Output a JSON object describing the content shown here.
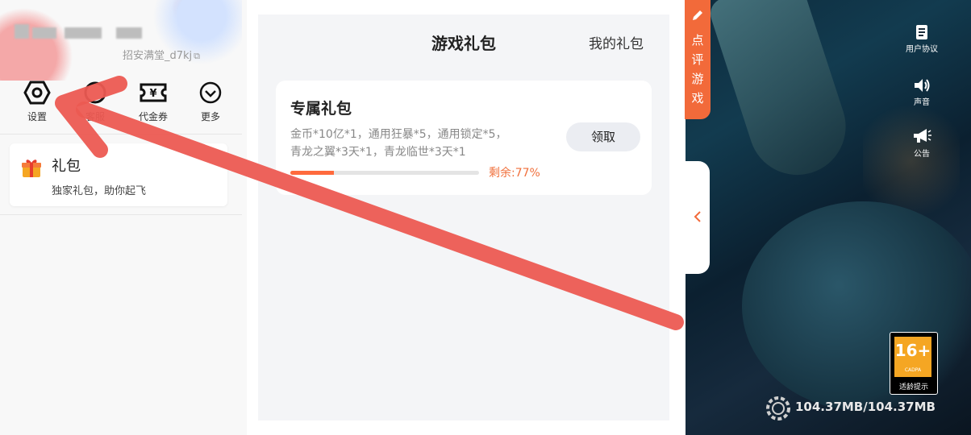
{
  "profile": {
    "uid_text": "招安满堂_d7kj"
  },
  "quick_actions": [
    {
      "label": "设置",
      "icon": "settings-hexagon-icon"
    },
    {
      "label": "客服",
      "icon": "service-icon"
    },
    {
      "label": "代金券",
      "icon": "voucher-icon"
    },
    {
      "label": "更多",
      "icon": "more-chevron-icon"
    }
  ],
  "gift_card": {
    "title": "礼包",
    "subtitle": "独家礼包，助你起飞",
    "icon": "gift-box-icon"
  },
  "gift_page": {
    "title": "游戏礼包",
    "my_gifts_link": "我的礼包",
    "package": {
      "title": "专属礼包",
      "desc_line1": "金币*10亿*1，通用狂暴*5，通用锁定*5，",
      "desc_line2": "青龙之翼*3天*1，青龙临世*3天*1",
      "claim_label": "领取",
      "remaining_text": "剩余:77%",
      "progress_fraction": 0.23
    }
  },
  "game_side": {
    "comment_tab": "点评游戏",
    "buttons": [
      {
        "label": "用户协议",
        "icon": "document-icon"
      },
      {
        "label": "声音",
        "icon": "speaker-icon"
      },
      {
        "label": "公告",
        "icon": "megaphone-icon"
      }
    ],
    "age_rating": {
      "number": "16+",
      "brand": "CADPA",
      "hint": "适龄提示"
    },
    "download_text": "104.37MB/104.37MB"
  },
  "colors": {
    "accent_orange": "#f26a3a",
    "progress": "#ff6a3d",
    "annotation_arrow": "#ec5a52"
  }
}
